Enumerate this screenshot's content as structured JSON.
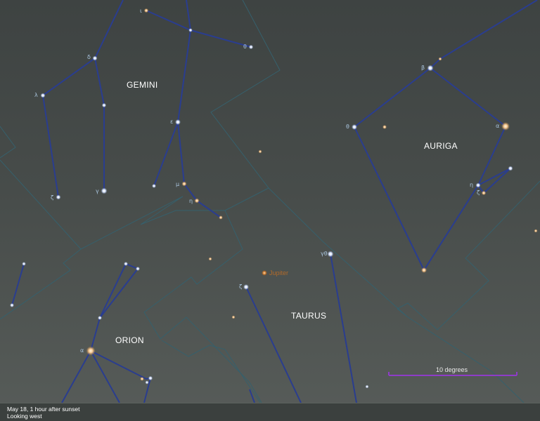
{
  "map": {
    "constellations": [
      "GEMINI",
      "AURIGA",
      "TAURUS",
      "ORION"
    ],
    "star_labels": {
      "gem_iota": "ι",
      "gem_theta": "θ",
      "gem_delta": "δ",
      "gem_lambda": "λ",
      "gem_epsilon": "ε",
      "gem_mu": "μ",
      "gem_eta": "η",
      "gem_zeta": "ζ",
      "gem_gamma": "γ",
      "aur_beta": "β",
      "aur_theta": "θ",
      "aur_alpha": "α",
      "aur_eta": "η",
      "aur_zeta": "ζ",
      "tau_gamma": "γθ",
      "tau_zeta": "ζ",
      "ori_alpha": "α"
    },
    "planet_label": "Jupiter",
    "scale_label": "10 degrees",
    "colors": {
      "constellation_lines": "#2a3d8f",
      "boundaries": "#36606c",
      "scale_bar": "#8e3cc8",
      "planet": "#c8782e",
      "star_blue": "#dfe8ff",
      "star_orange": "#f2c38a"
    }
  },
  "footer": {
    "line1": "May 18, 1 hour after sunset",
    "line2": "Looking west"
  }
}
